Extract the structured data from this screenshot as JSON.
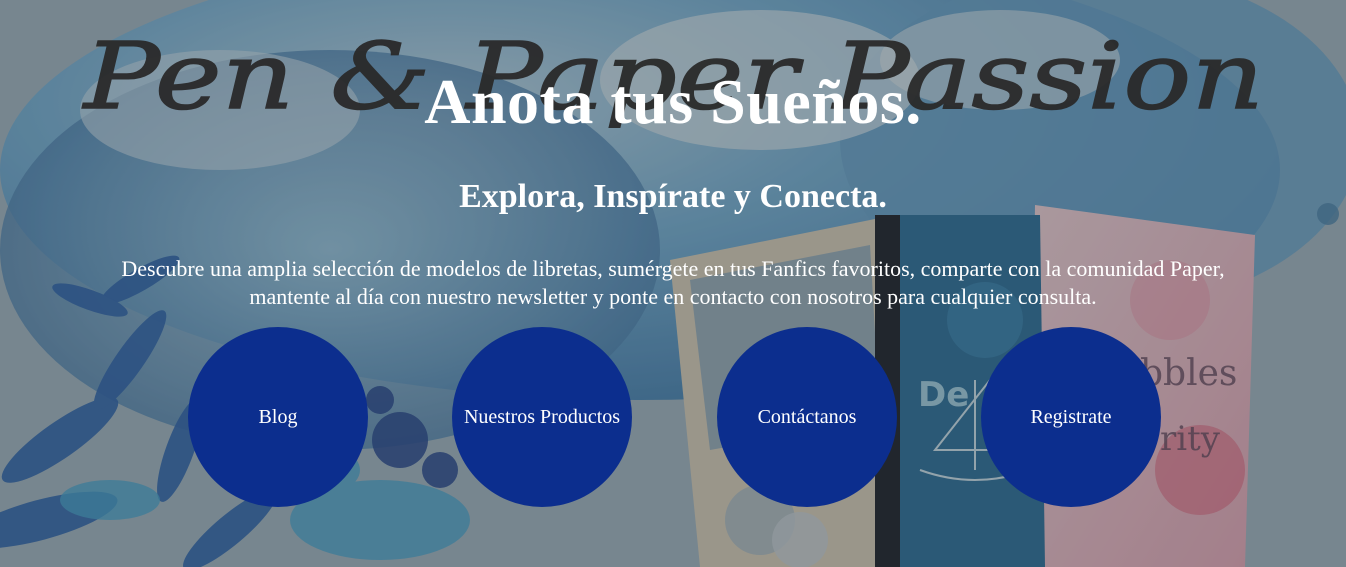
{
  "hero": {
    "background_script": "Pen & Paper Passion",
    "title": "Anota tus Sueños.",
    "subtitle": "Explora, Inspírate y Conecta.",
    "description_line1": "Descubre una amplia selección de modelos de libretas, sumérgete en tus Fanfics favoritos, comparte con la comunidad Paper,",
    "description_line2": "mantente al día con nuestro newsletter y ponte en contacto con nosotros para cualquier consulta."
  },
  "nav_buttons": [
    {
      "label": "Blog"
    },
    {
      "label": "Nuestros Productos"
    },
    {
      "label": "Contáctanos"
    },
    {
      "label": "Registrate"
    }
  ],
  "colors": {
    "button_bg": "#0c2e8e",
    "text": "#ffffff",
    "watercolor_blue": "#3f8fc4"
  }
}
